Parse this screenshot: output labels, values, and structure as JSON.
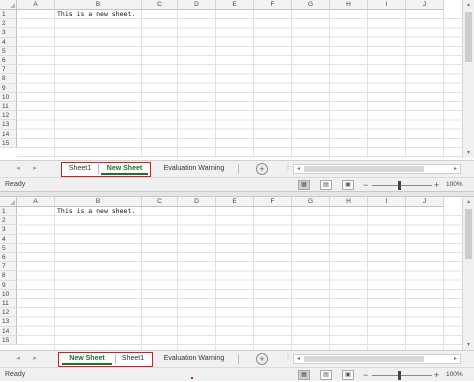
{
  "columns": [
    "A",
    "B",
    "C",
    "D",
    "E",
    "F",
    "G",
    "H",
    "I",
    "J"
  ],
  "rows_top": [
    "1",
    "2",
    "3",
    "4",
    "5",
    "6",
    "7",
    "8",
    "9",
    "10",
    "11",
    "12",
    "13",
    "14",
    "15"
  ],
  "rows_bottom": [
    "1",
    "2",
    "3",
    "4",
    "5",
    "6",
    "7",
    "8",
    "9",
    "10",
    "11",
    "12",
    "13",
    "14",
    "15"
  ],
  "cell_b1": "This is a new sheet.",
  "top_window": {
    "tabs": [
      "Sheet1",
      "New Sheet",
      "Evaluation Warning"
    ],
    "active_tab": "New Sheet",
    "status": "Ready",
    "zoom": "100%",
    "zoom_minus": "−",
    "zoom_plus": "+",
    "add_sheet": "+"
  },
  "bottom_window": {
    "tabs": [
      "New Sheet",
      "Sheet1",
      "Evaluation Warning"
    ],
    "active_tab": "New Sheet",
    "status": "Ready",
    "zoom": "100%",
    "zoom_minus": "−",
    "zoom_plus": "+",
    "add_sheet": "+"
  },
  "icons": {
    "prev_sheet": "◂",
    "next_sheet": "▸",
    "scroll_up": "▴",
    "scroll_down": "▾",
    "scroll_left": "◂",
    "scroll_right": "▸",
    "view_normal": "▦",
    "view_page_layout": "▤",
    "view_page_break": "▣"
  },
  "colors": {
    "tab_highlight": "#d81b1b",
    "active_tab_text": "#1e6f2d"
  }
}
